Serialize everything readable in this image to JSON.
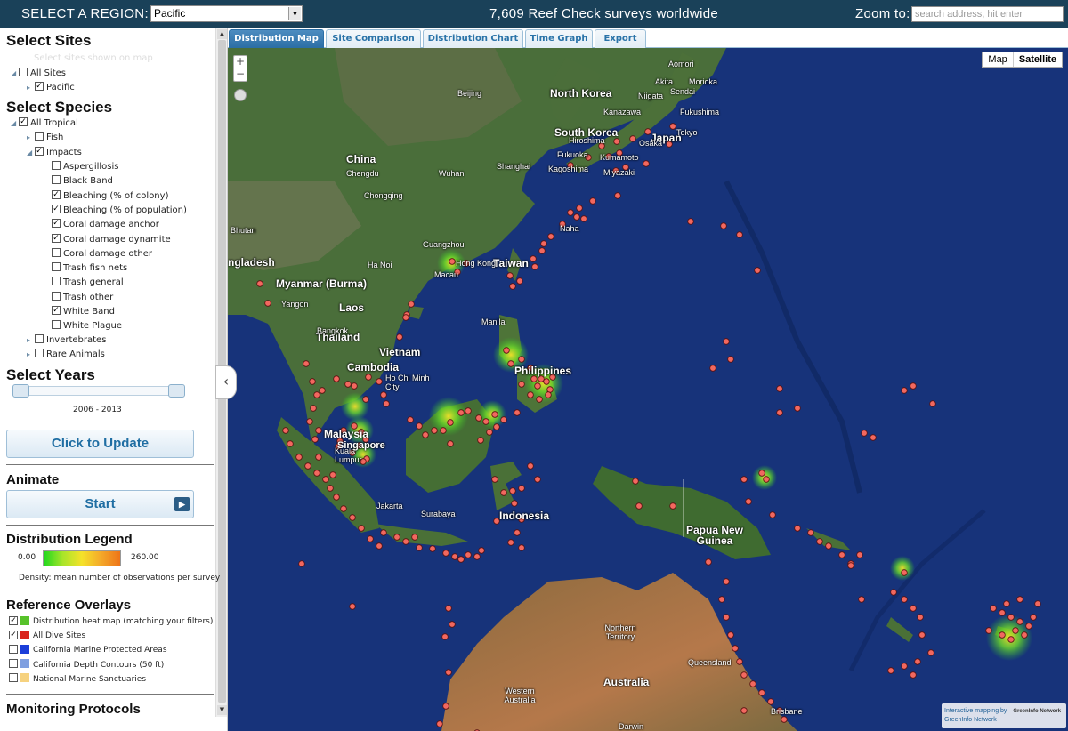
{
  "topbar": {
    "region_label": "SELECT A REGION:",
    "region_value": "Pacific",
    "survey_count": "7,609 Reef Check surveys worldwide",
    "zoom_label": "Zoom to:",
    "zoom_placeholder": "search address, hit enter"
  },
  "sidebar": {
    "sites": {
      "title": "Select Sites",
      "hint": "Select sites shown on map",
      "items": [
        {
          "label": "All Sites",
          "checked": false
        },
        {
          "label": "Pacific",
          "checked": true
        }
      ]
    },
    "species": {
      "title": "Select Species",
      "all": {
        "label": "All Tropical",
        "checked": true
      },
      "fish": {
        "label": "Fish",
        "checked": false
      },
      "impacts": {
        "label": "Impacts",
        "checked": true
      },
      "impact_items": [
        {
          "label": "Aspergillosis",
          "checked": false
        },
        {
          "label": "Black Band",
          "checked": false
        },
        {
          "label": "Bleaching (% of colony)",
          "checked": true
        },
        {
          "label": "Bleaching (% of population)",
          "checked": true
        },
        {
          "label": "Coral damage anchor",
          "checked": true
        },
        {
          "label": "Coral damage dynamite",
          "checked": true
        },
        {
          "label": "Coral damage other",
          "checked": false
        },
        {
          "label": "Trash fish nets",
          "checked": false
        },
        {
          "label": "Trash general",
          "checked": false
        },
        {
          "label": "Trash other",
          "checked": false
        },
        {
          "label": "White Band",
          "checked": true
        },
        {
          "label": "White Plague",
          "checked": false
        }
      ],
      "invertebrates": {
        "label": "Invertebrates",
        "checked": false
      },
      "rare": {
        "label": "Rare Animals",
        "checked": false
      }
    },
    "years": {
      "title": "Select Years",
      "range": "2006 - 2013",
      "start_fraction": 0.0,
      "end_fraction": 1.0
    },
    "update_button": "Click to Update",
    "animate": {
      "title": "Animate",
      "button": "Start"
    },
    "legend": {
      "title": "Distribution Legend",
      "min": "0.00",
      "max": "260.00",
      "note": "Density: mean number of observations per survey"
    },
    "overlays": {
      "title": "Reference Overlays",
      "items": [
        {
          "label": "Distribution heat map (matching your filters)",
          "checked": true,
          "color": "#57c22b"
        },
        {
          "label": "All Dive Sites",
          "checked": true,
          "color": "#d9231b"
        },
        {
          "label": "California Marine Protected Areas",
          "checked": false,
          "color": "#1b3ed9"
        },
        {
          "label": "California Depth Contours (50 ft)",
          "checked": false,
          "color": "#7f9fe0"
        },
        {
          "label": "National Marine Sanctuaries",
          "checked": false,
          "color": "#f6d27f"
        }
      ]
    },
    "protocols": {
      "title": "Monitoring Protocols"
    }
  },
  "tabs": [
    {
      "label": "Distribution Map",
      "active": true
    },
    {
      "label": "Site Comparison",
      "active": false
    },
    {
      "label": "Distribution Chart",
      "active": false
    },
    {
      "label": "Time Graph",
      "active": false
    },
    {
      "label": "Export",
      "active": false
    }
  ],
  "map": {
    "type_map": "Map",
    "type_satellite": "Satellite",
    "zoom_in": "+",
    "zoom_out": "−",
    "credit_line1": "Interactive mapping by",
    "credit_line2": "GreenInfo Network",
    "credit_logo": "GreenInfo Network",
    "labels": {
      "north_korea": "North Korea",
      "south_korea": "South Korea",
      "japan": "Japan",
      "china": "China",
      "taiwan": "Taiwan",
      "myanmar": "Myanmar (Burma)",
      "laos": "Laos",
      "thailand": "Thailand",
      "cambodia": "Cambodia",
      "vietnam": "Vietnam",
      "philippines": "Philippines",
      "malaysia": "Malaysia",
      "indonesia": "Indonesia",
      "png": "Papua New Guinea",
      "australia": "Australia",
      "bangladesh": "ngladesh",
      "bhutan": "Bhutan",
      "beijing": "Beijing",
      "aomori": "Aomori",
      "akita": "Akita",
      "morioka": "Morioka",
      "niigata": "Niigata",
      "sendai": "Sendai",
      "kanazawa": "Kanazawa",
      "fukushima": "Fukushima",
      "tokyo": "Tokyo",
      "hiroshima": "Hiroshima",
      "osaka": "Osaka",
      "fukuoka": "Fukuoka",
      "kumamoto": "Kumamoto",
      "kagoshima": "Kagoshima",
      "miyazaki": "Miyazaki",
      "chengdu": "Chengdu",
      "wuhan": "Wuhan",
      "shanghai": "Shanghai",
      "chongqing": "Chongqing",
      "guangzhou": "Guangzhou",
      "hongkong": "Hong Kong",
      "macau": "Macau",
      "naha": "Naha",
      "hanoi": "Ha Noi",
      "yangon": "Yangon",
      "bangkok": "Bangkok",
      "hcmc": "Ho Chi Minh City",
      "manila": "Manila",
      "kl": "Kuala Lumpur",
      "singapore": "Singapore",
      "jakarta": "Jakarta",
      "surabaya": "Surabaya",
      "northern_territory": "Northern Territory",
      "queensland": "Queensland",
      "western_australia": "Western Australia",
      "brisbane": "Brisbane",
      "darwin": "Darwin"
    }
  },
  "colors": {
    "topbar": "#1a4159",
    "tab_active": "#2b6ea5",
    "ocean": "#17337a",
    "land": "#3f6a31",
    "site_dot": "#f2685f",
    "heat": "#4fd62a"
  }
}
